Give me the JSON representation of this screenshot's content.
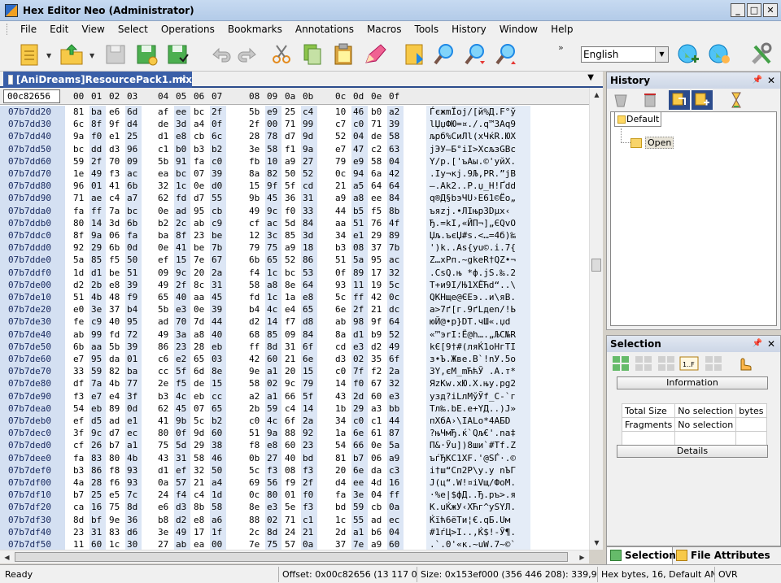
{
  "window": {
    "title": "Hex Editor Neo (Administrator)"
  },
  "menu": [
    "File",
    "Edit",
    "View",
    "Select",
    "Operations",
    "Bookmarks",
    "Annotations",
    "Macros",
    "Tools",
    "History",
    "Window",
    "Help"
  ],
  "toolbar": {
    "language": "English"
  },
  "document_tab": {
    "label": "[AniDreams]ResourcePack1.mix"
  },
  "hex": {
    "offset_header": "00c82656",
    "columns": [
      "00",
      "01",
      "02",
      "03",
      "04",
      "05",
      "06",
      "07",
      "08",
      "09",
      "0a",
      "0b",
      "0c",
      "0d",
      "0e",
      "0f"
    ],
    "rows": [
      {
        "off": "07b7dd20",
        "bytes": [
          "81",
          "ba",
          "e6",
          "6d",
          "af",
          "ee",
          "bc",
          "2f",
          "5b",
          "e9",
          "25",
          "c4",
          "10",
          "46",
          "b0",
          "a2"
        ],
        "ascii": "ЃєжmЇоj/[й%Д.F°ў"
      },
      {
        "off": "07b7dd30",
        "bytes": [
          "6c",
          "8f",
          "9f",
          "d4",
          "de",
          "3d",
          "a4",
          "0f",
          "2f",
          "00",
          "71",
          "99",
          "c7",
          "c0",
          "71",
          "39"
        ],
        "ascii": "lЏџФЮ=¤./.q™ЗАq9"
      },
      {
        "off": "07b7dd40",
        "bytes": [
          "9a",
          "f0",
          "e1",
          "25",
          "d1",
          "e8",
          "cb",
          "6c",
          "28",
          "78",
          "d7",
          "9d",
          "52",
          "04",
          "de",
          "58"
        ],
        "ascii": "љрб%СиЛl(xЧќR.ЮX"
      },
      {
        "off": "07b7dd50",
        "bytes": [
          "bc",
          "dd",
          "d3",
          "96",
          "c1",
          "b0",
          "b3",
          "b2",
          "3e",
          "58",
          "f1",
          "9a",
          "e7",
          "47",
          "c2",
          "63"
        ],
        "ascii": "јЭУ–Б°іІ>XсљзGВc"
      },
      {
        "off": "07b7dd60",
        "bytes": [
          "59",
          "2f",
          "70",
          "09",
          "5b",
          "91",
          "fa",
          "c0",
          "fb",
          "10",
          "a9",
          "27",
          "79",
          "e9",
          "58",
          "04"
        ],
        "ascii": "Y/p.['ъАы.©'уйX."
      },
      {
        "off": "07b7dd70",
        "bytes": [
          "1e",
          "49",
          "f3",
          "ac",
          "ea",
          "bc",
          "07",
          "39",
          "8a",
          "82",
          "50",
          "52",
          "0c",
          "94",
          "6a",
          "42"
        ],
        "ascii": ".Iу¬кј.9Љ‚PR.”jB"
      },
      {
        "off": "07b7dd80",
        "bytes": [
          "96",
          "01",
          "41",
          "6b",
          "32",
          "1c",
          "0e",
          "d0",
          "15",
          "9f",
          "5f",
          "cd",
          "21",
          "a5",
          "64",
          "64"
        ],
        "ascii": "–.Ak2..Р.џ_Н!Ґdd"
      },
      {
        "off": "07b7dd90",
        "bytes": [
          "71",
          "ae",
          "c4",
          "a7",
          "62",
          "fd",
          "d7",
          "55",
          "9b",
          "45",
          "36",
          "31",
          "a9",
          "a8",
          "ee",
          "84"
        ],
        "ascii": "q®Д§bэЧU›E61©Ёо„"
      },
      {
        "off": "07b7dda0",
        "bytes": [
          "fa",
          "ff",
          "7a",
          "bc",
          "0e",
          "ad",
          "95",
          "cb",
          "49",
          "9c",
          "f0",
          "33",
          "44",
          "b5",
          "f5",
          "8b"
        ],
        "ascii": "ъяzј.­•ЛIњр3Dµх‹"
      },
      {
        "off": "07b7ddb0",
        "bytes": [
          "80",
          "14",
          "3d",
          "6b",
          "b2",
          "2c",
          "ab",
          "c9",
          "cf",
          "ac",
          "5d",
          "84",
          "aa",
          "51",
          "76",
          "4f"
        ],
        "ascii": "Ђ.=kІ,«ЙП¬]„ЄQvO"
      },
      {
        "off": "07b7ddc0",
        "bytes": [
          "8f",
          "9a",
          "06",
          "fa",
          "ba",
          "8f",
          "23",
          "be",
          "12",
          "3c",
          "85",
          "3d",
          "34",
          "e1",
          "29",
          "89"
        ],
        "ascii": "Џљ.ъєЏ#ѕ.<…=4б)‰"
      },
      {
        "off": "07b7ddd0",
        "bytes": [
          "92",
          "29",
          "6b",
          "0d",
          "0e",
          "41",
          "be",
          "7b",
          "79",
          "75",
          "a9",
          "18",
          "b3",
          "08",
          "37",
          "7b"
        ],
        "ascii": "')k..Aѕ{yu©.і.7{"
      },
      {
        "off": "07b7dde0",
        "bytes": [
          "5a",
          "85",
          "f5",
          "50",
          "ef",
          "15",
          "7e",
          "67",
          "6b",
          "65",
          "52",
          "86",
          "51",
          "5a",
          "95",
          "ac"
        ],
        "ascii": "Z…хPп.~gkeR†QZ•¬"
      },
      {
        "off": "07b7ddf0",
        "bytes": [
          "1d",
          "d1",
          "be",
          "51",
          "09",
          "9c",
          "20",
          "2a",
          "f4",
          "1c",
          "bc",
          "53",
          "0f",
          "89",
          "17",
          "32"
        ],
        "ascii": ".СѕQ.њ *ф.јS.‰.2"
      },
      {
        "off": "07b7de00",
        "bytes": [
          "d2",
          "2b",
          "e8",
          "39",
          "49",
          "2f",
          "8c",
          "31",
          "58",
          "a8",
          "8e",
          "64",
          "93",
          "11",
          "19",
          "5c"
        ],
        "ascii": "Т+и9I/Њ1XЁЋd“..\\"
      },
      {
        "off": "07b7de10",
        "bytes": [
          "51",
          "4b",
          "48",
          "f9",
          "65",
          "40",
          "aa",
          "45",
          "fd",
          "1c",
          "1a",
          "e8",
          "5c",
          "ff",
          "42",
          "0c"
        ],
        "ascii": "QKHщe@ЄEэ..и\\яB."
      },
      {
        "off": "07b7de20",
        "bytes": [
          "e0",
          "3e",
          "37",
          "b4",
          "5b",
          "e3",
          "0e",
          "39",
          "b4",
          "4c",
          "e4",
          "65",
          "6e",
          "2f",
          "21",
          "dc"
        ],
        "ascii": "а>7ґ[г.9ґLдen/!Ь"
      },
      {
        "off": "07b7de30",
        "bytes": [
          "fe",
          "c9",
          "40",
          "95",
          "ad",
          "70",
          "7d",
          "44",
          "d2",
          "14",
          "f7",
          "d8",
          "ab",
          "98",
          "9f",
          "64"
        ],
        "ascii": "юЙ@•­p}DТ.чШ«.џd"
      },
      {
        "off": "07b7de40",
        "bytes": [
          "ab",
          "99",
          "fd",
          "72",
          "49",
          "3a",
          "a8",
          "40",
          "68",
          "85",
          "09",
          "84",
          "8a",
          "d1",
          "b9",
          "52"
        ],
        "ascii": "«™эrI:Ё@h….„ЉС№R"
      },
      {
        "off": "07b7de50",
        "bytes": [
          "6b",
          "aa",
          "5b",
          "39",
          "86",
          "23",
          "28",
          "eb",
          "ff",
          "8d",
          "31",
          "6f",
          "cd",
          "e3",
          "d2",
          "49"
        ],
        "ascii": "kЄ[9†#(ляЌ1oНгТI"
      },
      {
        "off": "07b7de60",
        "bytes": [
          "e7",
          "95",
          "da",
          "01",
          "c6",
          "e2",
          "65",
          "03",
          "42",
          "60",
          "21",
          "6e",
          "d3",
          "02",
          "35",
          "6f"
        ],
        "ascii": "з•Ъ.Жвe.B`!nУ.5o"
      },
      {
        "off": "07b7de70",
        "bytes": [
          "33",
          "59",
          "82",
          "ba",
          "cc",
          "5f",
          "6d",
          "8e",
          "9e",
          "a1",
          "20",
          "15",
          "c0",
          "7f",
          "f2",
          "2a"
        ],
        "ascii": "3Y‚єМ_mЋћЎ .А.т*"
      },
      {
        "off": "07b7de80",
        "bytes": [
          "df",
          "7a",
          "4b",
          "77",
          "2e",
          "f5",
          "de",
          "15",
          "58",
          "02",
          "9c",
          "79",
          "14",
          "f0",
          "67",
          "32"
        ],
        "ascii": "ЯzKw.хЮ.X.њy.рg2"
      },
      {
        "off": "07b7de90",
        "bytes": [
          "f3",
          "e7",
          "e4",
          "3f",
          "b3",
          "4c",
          "eb",
          "cc",
          "a2",
          "a1",
          "66",
          "5f",
          "43",
          "2d",
          "60",
          "e3"
        ],
        "ascii": "узд?іLлМўЎf_C-`г"
      },
      {
        "off": "07b7dea0",
        "bytes": [
          "54",
          "eb",
          "89",
          "0d",
          "62",
          "45",
          "07",
          "65",
          "2b",
          "59",
          "c4",
          "14",
          "1b",
          "29",
          "a3",
          "bb"
        ],
        "ascii": "Tл‰.bE.e+YД..)Ј»"
      },
      {
        "off": "07b7deb0",
        "bytes": [
          "ef",
          "d5",
          "ad",
          "e1",
          "41",
          "9b",
          "5c",
          "b2",
          "c0",
          "4c",
          "6f",
          "2a",
          "34",
          "c0",
          "c1",
          "44"
        ],
        "ascii": "пХ­бA›\\ІАLo*4АБD"
      },
      {
        "off": "07b7dec0",
        "bytes": [
          "3f",
          "9c",
          "d7",
          "ec",
          "80",
          "0f",
          "9d",
          "60",
          "51",
          "9a",
          "88",
          "92",
          "1a",
          "6e",
          "61",
          "87"
        ],
        "ascii": "?њЧмЂ.ќ`Qљ€'.na‡"
      },
      {
        "off": "07b7ded0",
        "bytes": [
          "cf",
          "26",
          "b7",
          "a1",
          "75",
          "5d",
          "29",
          "38",
          "f8",
          "e8",
          "60",
          "23",
          "54",
          "66",
          "0e",
          "5a"
        ],
        "ascii": "П&·Ўu])8ши`#Tf.Z"
      },
      {
        "off": "07b7dee0",
        "bytes": [
          "fa",
          "83",
          "80",
          "4b",
          "43",
          "31",
          "58",
          "46",
          "0b",
          "27",
          "40",
          "bd",
          "81",
          "b7",
          "06",
          "a9"
        ],
        "ascii": "ъѓЂKC1XF.'@ЅЃ·.©"
      },
      {
        "off": "07b7def0",
        "bytes": [
          "b3",
          "86",
          "f8",
          "93",
          "d1",
          "ef",
          "32",
          "50",
          "5c",
          "f3",
          "08",
          "f3",
          "20",
          "6e",
          "da",
          "c3"
        ],
        "ascii": "і†ш“Сп2P\\у.у nЪГ"
      },
      {
        "off": "07b7df00",
        "bytes": [
          "4a",
          "28",
          "f6",
          "93",
          "0a",
          "57",
          "21",
          "a4",
          "69",
          "56",
          "f9",
          "2f",
          "d4",
          "ee",
          "4d",
          "16"
        ],
        "ascii": "J(ц“.W!¤iVщ/ФоM."
      },
      {
        "off": "07b7df10",
        "bytes": [
          "b7",
          "25",
          "e5",
          "7c",
          "24",
          "f4",
          "c4",
          "1d",
          "0c",
          "80",
          "01",
          "f0",
          "fa",
          "3e",
          "04",
          "ff"
        ],
        "ascii": "·%е|$фД..Ђ.ръ>.я"
      },
      {
        "off": "07b7df20",
        "bytes": [
          "ca",
          "16",
          "75",
          "8d",
          "e6",
          "d3",
          "8b",
          "58",
          "8e",
          "e3",
          "5e",
          "f3",
          "bd",
          "59",
          "cb",
          "0a"
        ],
        "ascii": "К.uЌжУ‹XЋг^уЅYЛ."
      },
      {
        "off": "07b7df30",
        "bytes": [
          "8d",
          "bf",
          "9e",
          "36",
          "b8",
          "d2",
          "e8",
          "a6",
          "88",
          "02",
          "71",
          "c1",
          "1c",
          "55",
          "ad",
          "ec"
        ],
        "ascii": "Ќїћ6ёТи¦€.qБ.U­м"
      },
      {
        "off": "07b7df40",
        "bytes": [
          "23",
          "31",
          "83",
          "d6",
          "3e",
          "49",
          "17",
          "1f",
          "2c",
          "8d",
          "24",
          "21",
          "2d",
          "a1",
          "b6",
          "04"
        ],
        "ascii": "#1ѓЦ>I..,Ќ$!-Ў¶."
      },
      {
        "off": "07b7df50",
        "bytes": [
          "11",
          "60",
          "1c",
          "30",
          "27",
          "ab",
          "ea",
          "00",
          "7e",
          "75",
          "57",
          "0a",
          "37",
          "7e",
          "a9",
          "60"
        ],
        "ascii": ".`.0'«к.~uW.7~©`"
      },
      {
        "off": "07b7df60",
        "bytes": [
          "70",
          "71",
          "9c",
          "6e",
          "3d",
          "c3",
          "d8",
          "0e",
          "1e",
          "85",
          "08",
          "d9",
          "3b",
          "a1",
          "91",
          "99"
        ],
        "ascii": "pqњn=ГШ..….Щ;Ў'™"
      }
    ]
  },
  "history_panel": {
    "title": "History",
    "tab": "Default",
    "items": [
      "Open"
    ]
  },
  "selection_panel": {
    "title": "Selection",
    "information_label": "Information",
    "details_label": "Details",
    "rows": [
      {
        "label": "Total Size",
        "value": "No selection",
        "unit": "bytes"
      },
      {
        "label": "Fragments",
        "value": "No selection",
        "unit": ""
      }
    ]
  },
  "bottom_tabs": [
    "Selection",
    "File Attributes"
  ],
  "status": {
    "ready": "Ready",
    "offset": "Offset: 0x00c82656 (13 117 014)",
    "size": "Size: 0x153ef000 (356 446 208): 339,93 MB",
    "mode": "Hex bytes, 16, Default ANSI",
    "ovr": "OVR"
  }
}
